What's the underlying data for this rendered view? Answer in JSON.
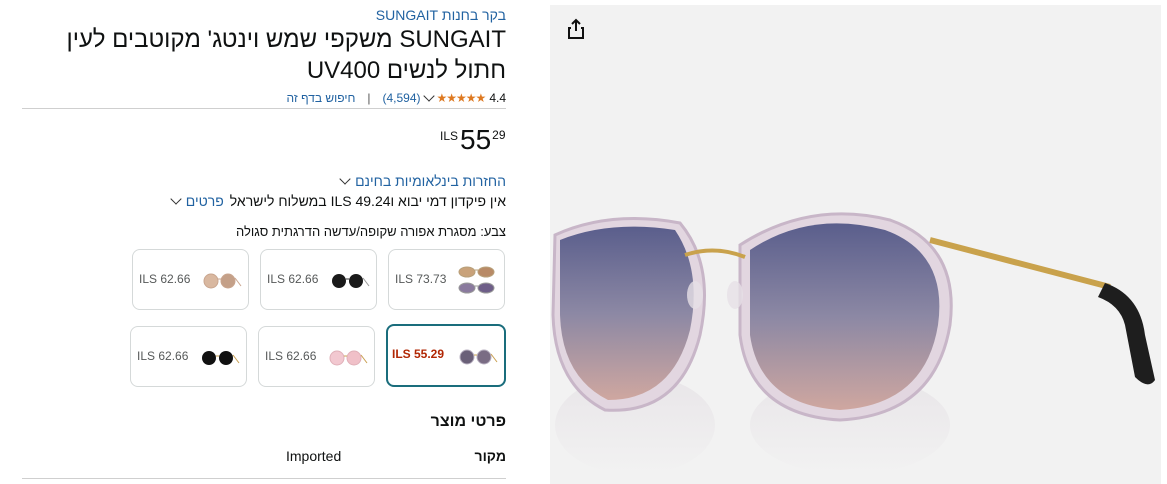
{
  "store_link": "בקר בחנות SUNGAIT",
  "title": "SUNGAIT משקפי שמש וינטג' מקוטבים לעין חתול לנשים UV400",
  "rating": {
    "value": "4.4",
    "stars": "★★★★★",
    "count": "(4,594)",
    "search_link": "חיפוש בדף זה"
  },
  "price": {
    "currency": "ILS",
    "whole": "55",
    "fraction": "29"
  },
  "returns_link": "החזרות בינלאומיות בחינם",
  "deposit": {
    "text": "אין פיקדון דמי יבוא וILS 49.24 במשלוח לישראל",
    "details": "פרטים"
  },
  "color": {
    "label": "צבע:",
    "value": "מסגרת אפורה שקופה/עדשה הדרגתית סגולה"
  },
  "swatches": [
    {
      "price": "ILS 73.73"
    },
    {
      "price": "ILS 62.66"
    },
    {
      "price": "ILS 62.66"
    },
    {
      "price": "ILS 55.29"
    },
    {
      "price": "ILS 62.66"
    },
    {
      "price": "ILS 62.66"
    }
  ],
  "product_details": {
    "header": "פרטי מוצר",
    "rows": [
      {
        "key": "מקור",
        "value": "Imported"
      }
    ]
  },
  "colors": {
    "accent": "#1a6d7c",
    "link": "#2162a1",
    "price_red": "#b12704",
    "star": "#de7921"
  },
  "icons": {
    "share": "share-icon"
  }
}
